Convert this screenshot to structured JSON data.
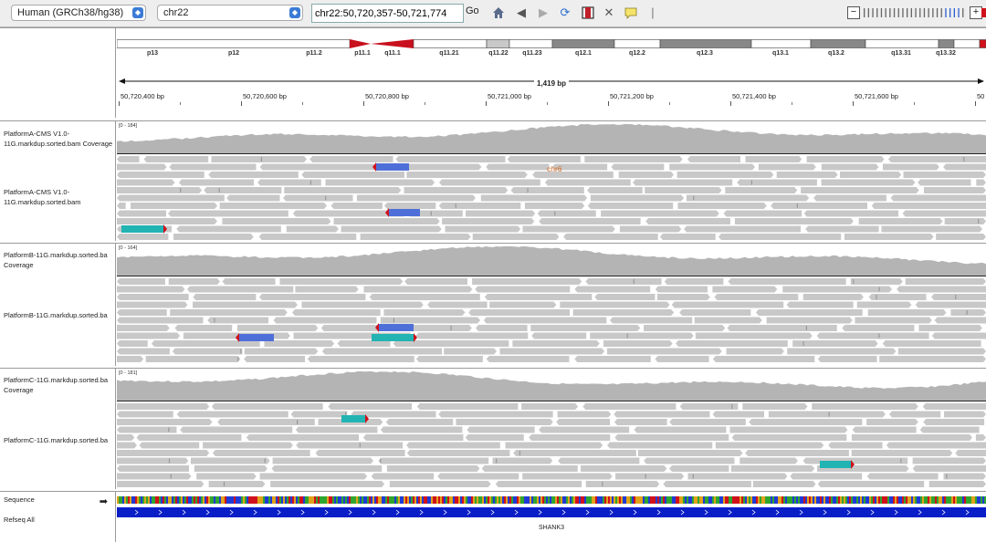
{
  "toolbar": {
    "genome": "Human (GRCh38/hg38)",
    "chromosome": "chr22",
    "locus": "chr22:50,720,357-50,721,774",
    "go_label": "Go",
    "icons": [
      "home-icon",
      "back-icon",
      "forward-icon",
      "refresh-icon",
      "region-of-interest-icon",
      "resize-icon",
      "popup-text-icon"
    ]
  },
  "ruler": {
    "bands": [
      "p13",
      "p12",
      "p11.2",
      "p11.1",
      "q11.1",
      "q11.21",
      "q11.22",
      "q11.23",
      "q12.1",
      "q12.2",
      "q12.3",
      "q13.1",
      "q13.2",
      "q13.31",
      "q13.32"
    ],
    "span": "1,419 bp",
    "positions": [
      "50,720,400 bp",
      "50,720,600 bp",
      "50,720,800 bp",
      "50,721,000 bp",
      "50,721,200 bp",
      "50,721,400 bp",
      "50,721,600 bp",
      "50"
    ]
  },
  "tracks": {
    "a_coverage": {
      "label": "PlatformA-CMS V1.0-11G.markdup.sorted.bam Coverage",
      "range": "[0 - 184]"
    },
    "a_reads": {
      "label": "PlatformA-CMS V1.0-11G.markdup.sorted.bam",
      "insert_text": "chr6"
    },
    "b_coverage": {
      "label": "PlatformB-11G.markdup.sorted.ba Coverage",
      "range": "[0 - 164]"
    },
    "b_reads": {
      "label": "PlatformB-11G.markdup.sorted.ba"
    },
    "c_coverage": {
      "label": "PlatformC-11G.markdup.sorted.ba Coverage",
      "range": "[0 - 181]"
    },
    "c_reads": {
      "label": "PlatformC-11G.markdup.sorted.ba"
    },
    "sequence": {
      "label": "Sequence"
    },
    "refseq": {
      "label": "Refseq All",
      "gene": "SHANK3"
    }
  },
  "colors": {
    "read": "#c8c8c8",
    "coverage": "#b4b4b4",
    "discordant_blue": "#4f6fd8",
    "discordant_teal": "#22b3b3",
    "strand_red": "#d0111b",
    "gene_blue": "#0a1ec8",
    "centromere": "#c8101e"
  }
}
